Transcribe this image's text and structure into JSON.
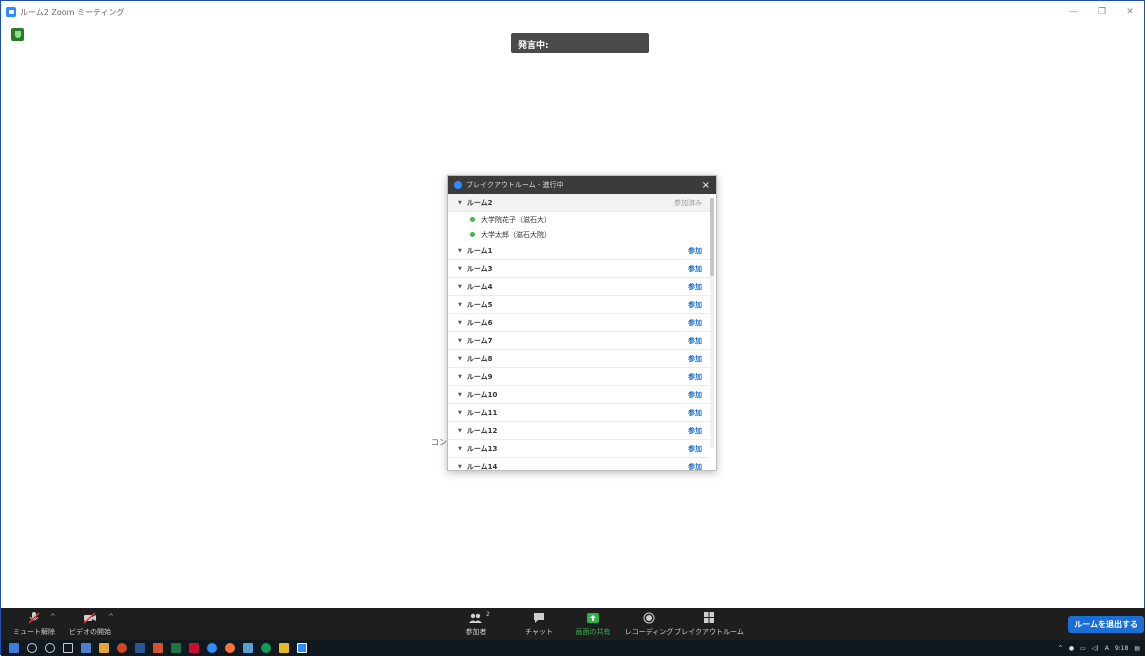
{
  "window": {
    "title": "ルーム2 Zoom ミーティング",
    "minimize": "—",
    "restore": "❐",
    "close": "✕"
  },
  "speaking_banner": "発言中:",
  "content_hint": "コン",
  "breakout": {
    "title": "ブレイクアウトルーム - 進行中",
    "close": "×",
    "active_room": {
      "name": "ルーム2",
      "status": "参加済み",
      "members": [
        "大学院花子（滋石大）",
        "大学太郎（滋石大院）"
      ]
    },
    "join_label": "参加",
    "rooms": [
      "ルーム1",
      "ルーム3",
      "ルーム4",
      "ルーム5",
      "ルーム6",
      "ルーム7",
      "ルーム8",
      "ルーム9",
      "ルーム10",
      "ルーム11",
      "ルーム12",
      "ルーム13",
      "ルーム14"
    ]
  },
  "toolbar": {
    "mute": "ミュート解除",
    "video": "ビデオの開始",
    "participants": "参加者",
    "participants_count": "2",
    "chat": "チャット",
    "share": "画面の共有",
    "record": "レコーディング",
    "breakout": "ブレイクアウトルーム",
    "leave": "ルームを退出する"
  },
  "taskbar": {
    "time": "9:18",
    "ime": "A"
  },
  "colors": {
    "accent": "#1a6fd6",
    "toolbar_bg": "#1e1e1e",
    "share_green": "#2fb34a"
  }
}
